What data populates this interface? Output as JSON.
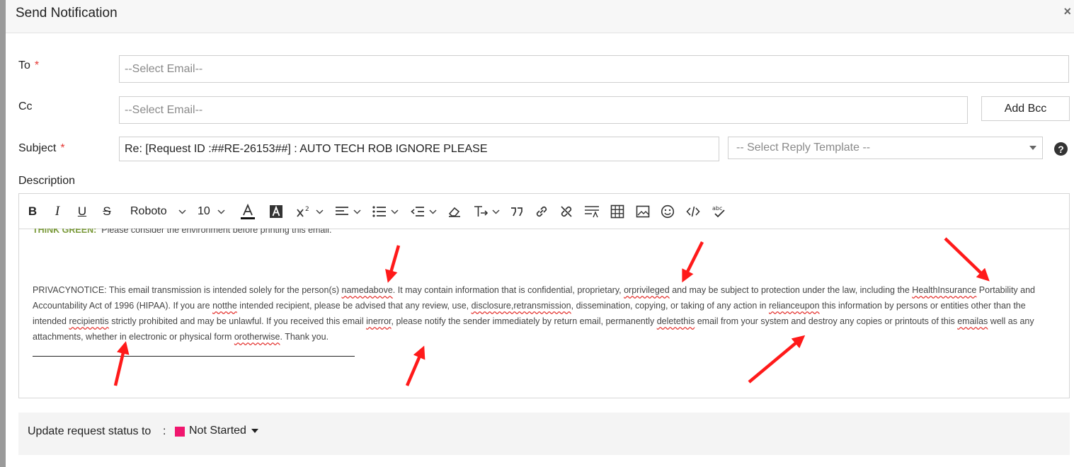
{
  "dialog": {
    "title": "Send Notification",
    "close_glyph": "×"
  },
  "form": {
    "to": {
      "label": "To",
      "required_mark": "*",
      "placeholder": "--Select Email--"
    },
    "cc": {
      "label": "Cc",
      "placeholder": "--Select Email--",
      "add_bcc": "Add Bcc"
    },
    "subject": {
      "label": "Subject",
      "required_mark": "*",
      "value": "Re: [Request ID :##RE-26153##] : AUTO TECH ROB IGNORE PLEASE"
    },
    "reply_template": {
      "selected": "-- Select Reply Template --"
    },
    "help_glyph": "?",
    "description_label": "Description"
  },
  "toolbar": {
    "bold": "B",
    "italic": "I",
    "underline": "U",
    "strike": "S",
    "font_family": "Roboto",
    "font_size": "10",
    "icons": [
      "bold-icon",
      "italic-icon",
      "underline-icon",
      "strikethrough-icon",
      "font-color-icon",
      "highlight-icon",
      "superscript-icon",
      "align-icon",
      "list-icon",
      "indent-icon",
      "eraser-icon",
      "text-direction-icon",
      "quote-icon",
      "link-icon",
      "unlink-icon",
      "line-height-icon",
      "table-icon",
      "image-icon",
      "emoji-icon",
      "code-icon",
      "spellcheck-icon"
    ]
  },
  "editor": {
    "think_green_label": "THINK GREEN:",
    "think_green_text": "Please consider the environment before printing this email.",
    "privacy": {
      "p1": "PRIVACYNOTICE: This email transmission is intended solely for the person(s) ",
      "w1": "namedabove",
      "p2": ".  It may contain information that is confidential, proprietary, ",
      "w2": "orprivileged",
      "p3": " and may be subject to protection under the law, including the ",
      "w3": "HealthInsurance",
      "p4": " Portability and Accountability Act of 1996 (HIPAA). If you are ",
      "w4": "notthe",
      "p5": " intended recipient, please be advised that any review, use, ",
      "w5": "disclosure,retransmission",
      "p6": ", dissemination, copying, or taking of any action in ",
      "w6": "relianceupon",
      "p7": " this information by persons or entities other than the intended ",
      "w7": "recipientis",
      "p8": " strictly prohibited and may be unlawful. If you received this email ",
      "w8": "inerror",
      "p9": ", please notify the sender immediately by return email, permanently ",
      "w9": "deletethis",
      "p10": " email from your system and destroy any copies or printouts of this ",
      "w10": "emailas",
      "p11": " well as any attachments, whether in electronic or physical form ",
      "w11": "orotherwise",
      "p12": ". Thank you."
    },
    "annotation_color": "#ff1a1a"
  },
  "footer": {
    "label": "Update request status to",
    "colon": ":",
    "status": "Not Started",
    "status_color": "#f0166e"
  }
}
